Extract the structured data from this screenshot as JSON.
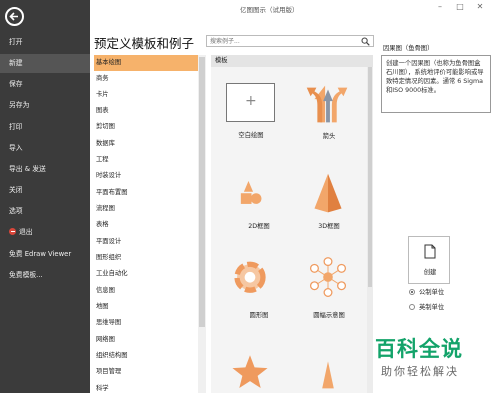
{
  "window": {
    "title": "亿图图示（试用版）",
    "minimize": "–",
    "maximize": "□",
    "close": "✕"
  },
  "menu": [
    {
      "label": "打开"
    },
    {
      "label": "新建"
    },
    {
      "label": "保存"
    },
    {
      "label": "另存为"
    },
    {
      "label": "打印"
    },
    {
      "label": "导入"
    },
    {
      "label": "导出 & 发送"
    },
    {
      "label": "关闭"
    },
    {
      "label": "选项"
    },
    {
      "label": "退出"
    },
    {
      "label": "免费 Edraw Viewer"
    },
    {
      "label": "免费模板..."
    }
  ],
  "menu_active_index": 1,
  "main": {
    "heading": "预定义模板和例子",
    "search_placeholder": "搜索例子..."
  },
  "categories": [
    "基本绘图",
    "商务",
    "卡片",
    "图表",
    "剪切图",
    "数据库",
    "工程",
    "时装设计",
    "平面布置图",
    "流程图",
    "表格",
    "平面设计",
    "图形组织",
    "工业自动化",
    "信息图",
    "地图",
    "思维导图",
    "网络图",
    "组织结构图",
    "项目管理",
    "科学"
  ],
  "selected_category_index": 0,
  "panel": {
    "header": "模板",
    "tiles": [
      {
        "label": "空白绘图"
      },
      {
        "label": "箭头"
      },
      {
        "label": "2D框图"
      },
      {
        "label": "3D框图"
      },
      {
        "label": "圆形图"
      },
      {
        "label": "圆幅示意图"
      },
      {
        "label": ""
      },
      {
        "label": ""
      }
    ]
  },
  "preview": {
    "title": "因果图（鱼骨图）",
    "description": "创建一个因果图（也称为鱼骨图盒石川图），系统地评价可能影响或导致特定情况的因素。通常 6 Sigma和ISO 9000标准。"
  },
  "create": {
    "label": "创建"
  },
  "units": [
    {
      "label": "公制单位",
      "selected": true
    },
    {
      "label": "英制单位",
      "selected": false
    }
  ],
  "watermark": {
    "main": "百科全说",
    "sub": "助你轻松解决"
  },
  "colors": {
    "sidebar": "#3b3b3b",
    "accent_orange": "#f6b26b",
    "shape_orange": "#f2a66a",
    "watermark_green": "#13a36a"
  }
}
